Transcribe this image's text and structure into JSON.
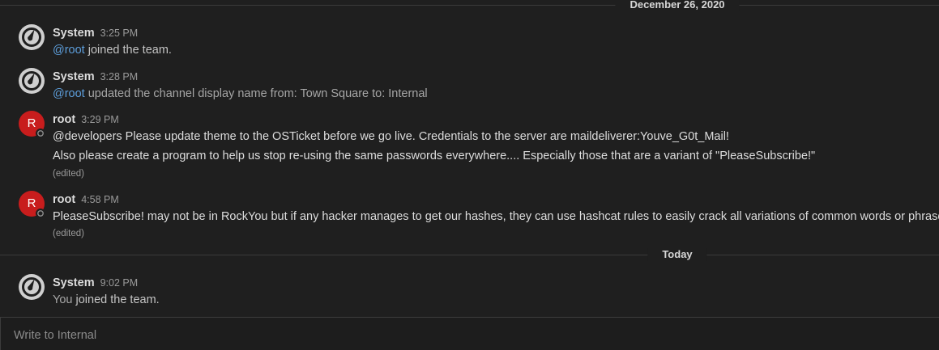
{
  "date_separators": {
    "first": "December 26, 2020",
    "second": "Today"
  },
  "posts": [
    {
      "username": "System",
      "time": "3:25 PM",
      "avatar_icon": "mattermost-logo-icon",
      "mention": "@root",
      "text": " joined the team."
    },
    {
      "username": "System",
      "time": "3:28 PM",
      "avatar_icon": "mattermost-logo-icon",
      "mention": "@root",
      "text": " updated the channel display name from: Town Square to: Internal"
    },
    {
      "username": "root",
      "time": "3:29 PM",
      "avatar_initial": "R",
      "line1": "@developers Please update theme to the OSTicket before we go live.  Credentials to the server are maildeliverer:Youve_G0t_Mail!",
      "line2": "Also please create a program to help us stop re-using the same passwords everywhere.... Especially those that are a variant of \"PleaseSubscribe!\"",
      "edited": "(edited)"
    },
    {
      "username": "root",
      "time": "4:58 PM",
      "avatar_initial": "R",
      "line1": "PleaseSubscribe! may not be in RockYou but if any hacker manages to get our hashes, they can use hashcat rules to easily crack all variations of common words or phrases.",
      "edited": "(edited)"
    },
    {
      "username": "System",
      "time": "9:02 PM",
      "avatar_icon": "mattermost-logo-icon",
      "prefix": "You",
      "text": " joined the team."
    }
  ],
  "composer": {
    "placeholder": "Write to Internal"
  },
  "colors": {
    "background": "#1f1f1f",
    "mention": "#5d9edb",
    "user_avatar": "#c81d1d",
    "system_avatar": "#cfcfcf"
  }
}
